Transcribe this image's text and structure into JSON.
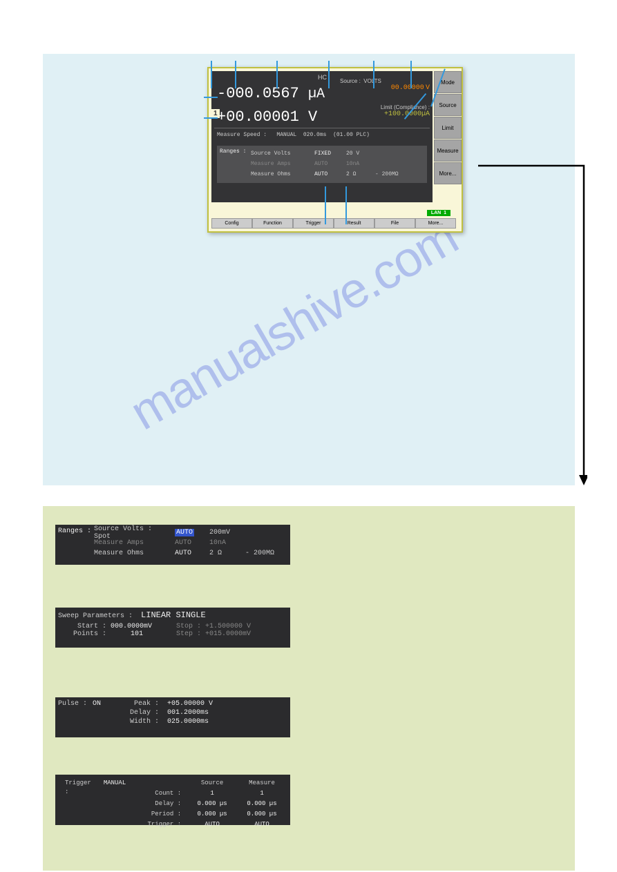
{
  "instrument": {
    "status_HC": "HC",
    "channel_label": "1",
    "main_reading": "-000.0567",
    "main_unit": "µA",
    "secondary_reading": "+00.00001",
    "secondary_unit": "V",
    "source_label": "Source :",
    "source_mode": "VOLTS",
    "source_value": "00.00000",
    "source_value_unit": "V",
    "limit_label": "Limit (Compliance) :",
    "limit_value": "+100.0000",
    "limit_unit": "µA",
    "speed_label": "Measure Speed :",
    "speed_mode": "MANUAL",
    "speed_time": "020.0ms",
    "speed_plc": "(01.00 PLC)",
    "ranges_title": "Ranges :",
    "ranges": [
      {
        "name": "Source Volts",
        "mode": "FIXED",
        "value": "20 V",
        "extra": ""
      },
      {
        "name": "Measure Amps",
        "mode": "AUTO",
        "value": "10nA",
        "extra": ""
      },
      {
        "name": "Measure Ohms",
        "mode": "AUTO",
        "value": "2 Ω",
        "extra": "- 200MΩ"
      }
    ],
    "side_buttons": [
      "Mode",
      "Source",
      "Limit",
      "Measure",
      "More..."
    ],
    "bottom_buttons": [
      "Config",
      "Function",
      "Trigger",
      "Result",
      "File",
      "More..."
    ],
    "lan_label": "LAN",
    "lan_val": "1"
  },
  "section_ranges": {
    "title": "Ranges :",
    "rows": [
      {
        "name": "Source Volts : Spot",
        "mode": "AUTO",
        "mode_hl": true,
        "value": "200mV",
        "extra": ""
      },
      {
        "name": "Measure Amps",
        "mode": "AUTO",
        "mode_hl": false,
        "value": "10nA",
        "extra": ""
      },
      {
        "name": "Measure Ohms",
        "mode": "AUTO",
        "mode_hl": false,
        "value": "2 Ω",
        "extra": "- 200MΩ"
      }
    ]
  },
  "section_sweep": {
    "title": "Sweep Parameters :",
    "type": "LINEAR SINGLE",
    "start_label": "Start :",
    "start_value": "000.0000mV",
    "stop_label": "Stop :",
    "stop_value": "+1.500000 V",
    "points_label": "Points :",
    "points_value": "101",
    "step_label": "Step :",
    "step_value": "+015.0000mV"
  },
  "section_pulse": {
    "title": "Pulse :",
    "state": "ON",
    "peak_label": "Peak :",
    "peak_value": "+05.00000 V",
    "delay_label": "Delay :",
    "delay_value": "001.2000ms",
    "width_label": "Width :",
    "width_value": "025.0000ms"
  },
  "section_trigger": {
    "title": "Trigger :",
    "mode": "MANUAL",
    "col_source": "Source",
    "col_measure": "Measure",
    "rows": [
      {
        "label": "Count :",
        "source": "1",
        "measure": "1"
      },
      {
        "label": "Delay :",
        "source": "0.000 µs",
        "measure": "0.000 µs"
      },
      {
        "label": "Period :",
        "source": "0.000 µs",
        "measure": "0.000 µs"
      },
      {
        "label": "Trigger :",
        "source": "AUTO",
        "measure": "AUTO"
      }
    ]
  },
  "watermark": "manualshive.com"
}
